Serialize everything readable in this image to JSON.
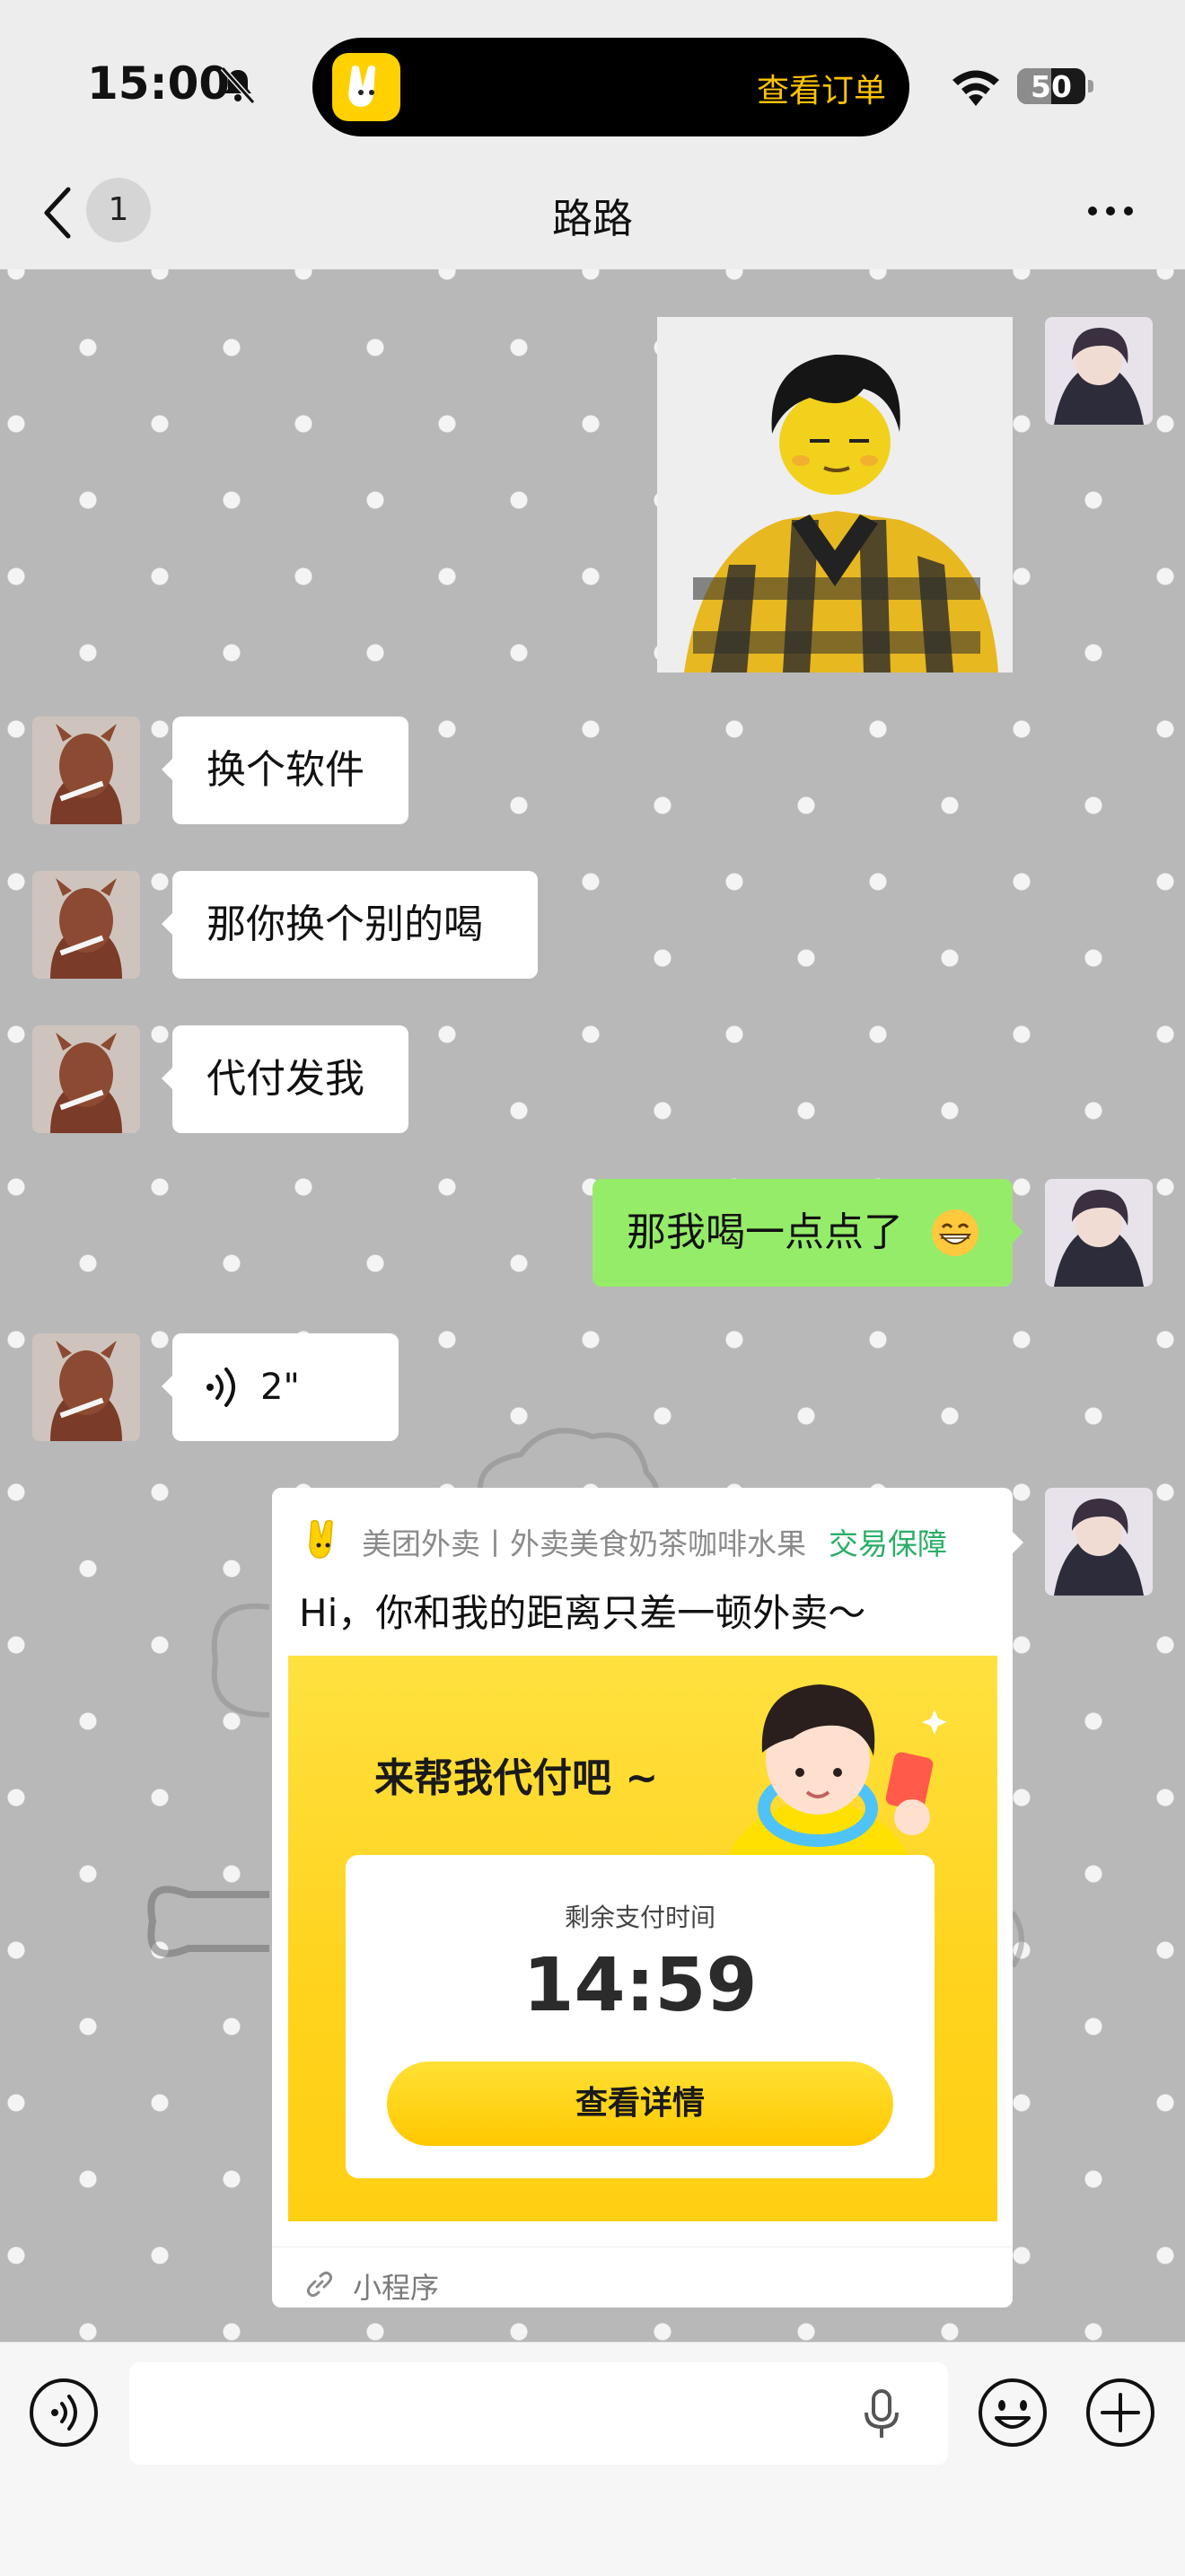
{
  "status_bar": {
    "time": "15:00",
    "island_text": "查看订单",
    "battery_level": "50",
    "battery_fraction": 0.5
  },
  "header": {
    "unread_count": "1",
    "title": "路路"
  },
  "messages": [
    {
      "from": "me",
      "type": "image",
      "description": "meme"
    },
    {
      "from": "other",
      "type": "text",
      "text": "换个软件"
    },
    {
      "from": "other",
      "type": "text",
      "text": "那你换个别的喝"
    },
    {
      "from": "other",
      "type": "text",
      "text": "代付发我"
    },
    {
      "from": "me",
      "type": "text",
      "text": "那我喝一点点了"
    },
    {
      "from": "other",
      "type": "voice",
      "duration": "2\""
    },
    {
      "from": "me",
      "type": "mini_program"
    }
  ],
  "mini_program": {
    "source": "美团外卖丨外卖美食奶茶咖啡水果",
    "guarantee": "交易保障",
    "title": "Hi，你和我的距离只差一顿外卖～",
    "banner_headline": "来帮我代付吧 ~",
    "timer_label": "剩余支付时间",
    "timer": "14:59",
    "button_label": "查看详情",
    "footer_label": "小程序"
  },
  "colors": {
    "my_bubble": "#95ec69",
    "their_bubble": "#ffffff",
    "brand_yellow": "#ffd100",
    "guarantee_green": "#2aae67",
    "chat_background": "#b8b8b8"
  },
  "icons": [
    "bell-slash-icon",
    "wifi-icon",
    "back-chevron-icon",
    "more-icon",
    "voice-wave-icon",
    "voice-mode-icon",
    "mic-icon",
    "emoji-icon",
    "plus-icon",
    "link-icon"
  ]
}
